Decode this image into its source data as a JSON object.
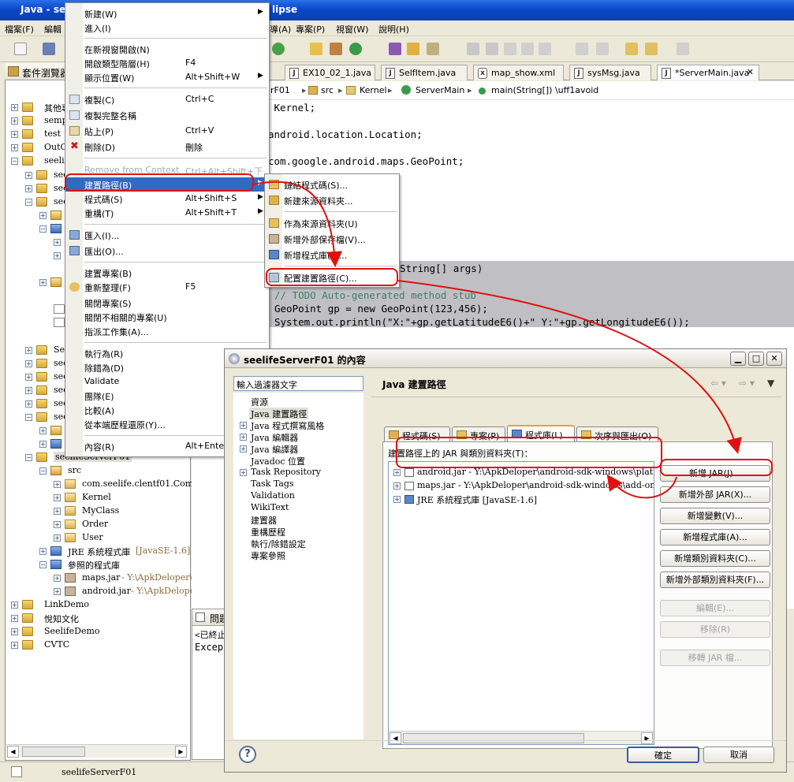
{
  "window": {
    "title_left": "Java - see",
    "title_right": "lipse"
  },
  "menubar": [
    {
      "label": "檔案(F)"
    },
    {
      "label": "編輯"
    },
    {
      "label": "導(A)"
    },
    {
      "label": "專案(P)"
    },
    {
      "label": "視窗(W)"
    },
    {
      "label": "說明(H)"
    }
  ],
  "explorer": {
    "tab_label": "套件瀏覽器",
    "items": [
      {
        "label": "其他專"
      },
      {
        "label": "semple"
      },
      {
        "label": "test"
      },
      {
        "label": "OutGet"
      },
      {
        "label": "seelife"
      },
      {
        "label": "see"
      },
      {
        "label": "see"
      },
      {
        "label": "see"
      },
      {
        "label": "See"
      },
      {
        "label": "see"
      },
      {
        "label": "see"
      },
      {
        "label": "see"
      },
      {
        "label": "see"
      },
      {
        "label": "see"
      },
      {
        "label": "seelifeServerF01"
      },
      {
        "label": "src"
      },
      {
        "label": "com.seelife.clentf01.Commu"
      },
      {
        "label": "Kernel"
      },
      {
        "label": "MyClass"
      },
      {
        "label": "Order"
      },
      {
        "label": "User"
      },
      {
        "label": "JRE 系統程式庫",
        "extra": "[JavaSE-1.6]"
      },
      {
        "label": "參照的程式庫"
      },
      {
        "label": "maps.jar",
        "extra": "- Y:\\ApkDeloper\\an"
      },
      {
        "label": "android.jar",
        "extra": "- Y:\\ApkDeloper"
      },
      {
        "label": "LinkDemo"
      },
      {
        "label": "悅知文化"
      },
      {
        "label": "SeelifeDemo"
      },
      {
        "label": "CVTC"
      }
    ]
  },
  "editor": {
    "tabs": [
      {
        "label": "EX10_02_1.java"
      },
      {
        "label": "SelfItem.java"
      },
      {
        "label": "map_show.xml"
      },
      {
        "label": "sysMsg.java"
      },
      {
        "label": "*ServerMain.java"
      }
    ],
    "breadcrumb": [
      "rF01",
      "src",
      "Kernel",
      "ServerMain",
      "main(String[]) \\uff1avoid"
    ],
    "code": [
      " Kernel;",
      "android.location.Location;",
      "com.google.android.maps.GeoPoint;",
      "String[] args)",
      "// TODO Auto-generated method stub",
      "GeoPoint gp = new GeoPoint(123,456);",
      "System.out.println(\"X:\"+gp.getLatitudeE6()+\" Y:\"+gp.getLongitudeE6());"
    ],
    "problems_tab": "問題",
    "console_lines": [
      "<已終止",
      "Excep"
    ]
  },
  "context_menu": {
    "items": [
      {
        "label": "新建(W)",
        "shortcut": "",
        "submenu": true
      },
      {
        "label": "進入(I)",
        "shortcut": ""
      },
      {
        "label": "在新視窗開啟(N)",
        "shortcut": ""
      },
      {
        "label": "開啟類型階層(H)",
        "shortcut": "F4"
      },
      {
        "label": "顯示位置(W)",
        "shortcut": "Alt+Shift+W",
        "submenu": true
      },
      {
        "label": "複製(C)",
        "shortcut": "Ctrl+C"
      },
      {
        "label": "複製完整名稱",
        "shortcut": ""
      },
      {
        "label": "貼上(P)",
        "shortcut": "Ctrl+V"
      },
      {
        "label": "刪除(D)",
        "shortcut": "刪除"
      },
      {
        "label": "Remove from Context",
        "shortcut": "Ctrl+Alt+Shift+下",
        "disabled": true
      },
      {
        "label": "建置路徑(B)",
        "shortcut": "",
        "submenu": true,
        "selected": true
      },
      {
        "label": "程式碼(S)",
        "shortcut": "Alt+Shift+S",
        "submenu": true
      },
      {
        "label": "重構(T)",
        "shortcut": "Alt+Shift+T",
        "submenu": true
      },
      {
        "label": "匯入(I)...",
        "shortcut": ""
      },
      {
        "label": "匯出(O)...",
        "shortcut": ""
      },
      {
        "label": "建置專案(B)",
        "shortcut": ""
      },
      {
        "label": "重新整理(F)",
        "shortcut": "F5"
      },
      {
        "label": "關閉專案(S)",
        "shortcut": ""
      },
      {
        "label": "關閉不相關的專案(U)",
        "shortcut": ""
      },
      {
        "label": "指派工作集(A)...",
        "shortcut": ""
      },
      {
        "label": "執行為(R)",
        "shortcut": "",
        "submenu": true
      },
      {
        "label": "除錯為(D)",
        "shortcut": "",
        "submenu": true
      },
      {
        "label": "Validate",
        "shortcut": ""
      },
      {
        "label": "團隊(E)",
        "shortcut": "",
        "submenu": true
      },
      {
        "label": "比較(A)",
        "shortcut": "",
        "submenu": true
      },
      {
        "label": "從本端歷程還原(Y)...",
        "shortcut": ""
      },
      {
        "label": "內容(R)",
        "shortcut": "Alt+Enter"
      }
    ]
  },
  "submenu": {
    "items": [
      {
        "label": "鏈結程式碼(S)..."
      },
      {
        "label": "新建來源資料夾..."
      },
      {
        "label": "作為來源資料夾(U)"
      },
      {
        "label": "新增外部保存檔(V)..."
      },
      {
        "label": "新增程式庫(L)..."
      },
      {
        "label": "配置建置路徑(C)..."
      }
    ]
  },
  "dialog": {
    "title": "seelifeServerF01 的內容",
    "filter_placeholder": "輸入過濾器文字",
    "nav": [
      {
        "label": "資源"
      },
      {
        "label": "Java 建置路徑"
      },
      {
        "label": "Java 程式撰寫風格"
      },
      {
        "label": "Java 編輯器"
      },
      {
        "label": "Java 編譯器"
      },
      {
        "label": "Javadoc 位置"
      },
      {
        "label": "Task Repository"
      },
      {
        "label": "Task Tags"
      },
      {
        "label": "Validation"
      },
      {
        "label": "WikiText"
      },
      {
        "label": "建置器"
      },
      {
        "label": "重構歷程"
      },
      {
        "label": "執行/除錯設定"
      },
      {
        "label": "專案參照"
      }
    ],
    "panel_title": "Java 建置路徑",
    "tabs": [
      {
        "label": "程式碼(S)"
      },
      {
        "label": "專案(P)"
      },
      {
        "label": "程式庫(L)"
      },
      {
        "label": "次序與匯出(O)"
      }
    ],
    "list_label": "建置路徑上的 JAR 與類別資料夾(T)：",
    "jars": [
      {
        "label": "android.jar - Y:\\ApkDeloper\\android-sdk-windows\\platforms\\a"
      },
      {
        "label": "maps.jar - Y:\\ApkDeloper\\android-sdk-windows\\add-ons\\addo:"
      },
      {
        "label": "JRE 系統程式庫 [JavaSE-1.6]"
      }
    ],
    "buttons": [
      {
        "label": "新增 JAR(J)...",
        "enabled": true
      },
      {
        "label": "新增外部 JAR(X)...",
        "enabled": true
      },
      {
        "label": "新增變數(V)...",
        "enabled": true
      },
      {
        "label": "新增程式庫(A)...",
        "enabled": true
      },
      {
        "label": "新增類別資料夾(C)...",
        "enabled": true
      },
      {
        "label": "新增外部類別資料夾(F)...",
        "enabled": true
      },
      {
        "label": "編輯(E)...",
        "enabled": false
      },
      {
        "label": "移除(R)",
        "enabled": false
      },
      {
        "label": "移轉 JAR 檔...",
        "enabled": false
      }
    ],
    "ok_label": "確定",
    "cancel_label": "取消",
    "help_glyph": "?"
  },
  "status": {
    "text": "seelifeServerF01"
  },
  "colors": {
    "titlebar": "#0a48c8",
    "selection": "#316ac5",
    "annotation": "#e01010"
  }
}
